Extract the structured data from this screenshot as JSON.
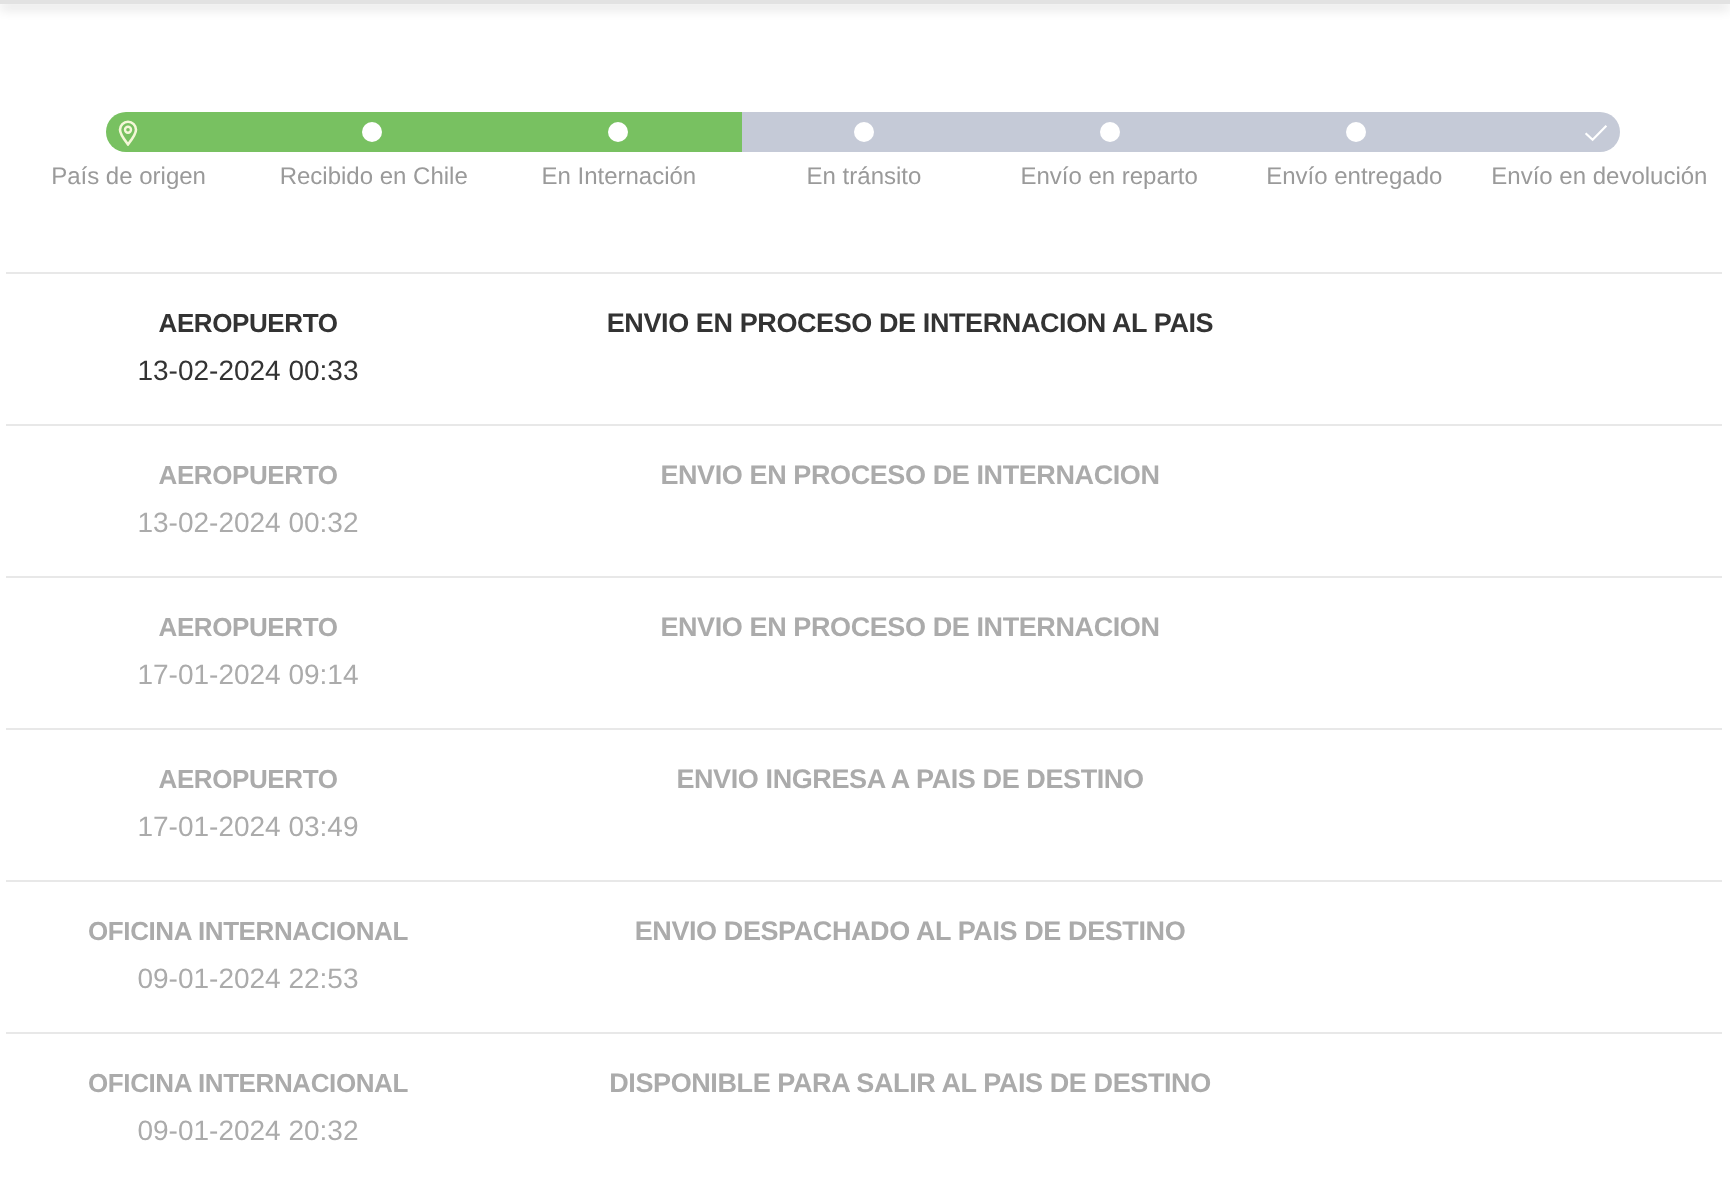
{
  "tracker": {
    "steps": [
      {
        "label": "País de origen",
        "kind": "origin",
        "done": true
      },
      {
        "label": "Recibido en Chile",
        "kind": "stage",
        "done": true
      },
      {
        "label": "En Internación",
        "kind": "stage",
        "done": true
      },
      {
        "label": "En tránsito",
        "kind": "stage",
        "done": false
      },
      {
        "label": "Envío en reparto",
        "kind": "stage",
        "done": false
      },
      {
        "label": "Envío entregado",
        "kind": "stage",
        "done": false
      },
      {
        "label": "Envío en devolución",
        "kind": "return",
        "done": false
      }
    ]
  },
  "events": [
    {
      "location": "AEROPUERTO",
      "datetime": "13-02-2024 00:33",
      "description": "ENVIO EN PROCESO DE INTERNACION AL PAIS",
      "current": true
    },
    {
      "location": "AEROPUERTO",
      "datetime": "13-02-2024 00:32",
      "description": "ENVIO EN PROCESO DE INTERNACION",
      "current": false
    },
    {
      "location": "AEROPUERTO",
      "datetime": "17-01-2024 09:14",
      "description": "ENVIO EN PROCESO DE INTERNACION",
      "current": false
    },
    {
      "location": "AEROPUERTO",
      "datetime": "17-01-2024 03:49",
      "description": "ENVIO INGRESA A PAIS DE DESTINO",
      "current": false
    },
    {
      "location": "OFICINA INTERNACIONAL",
      "datetime": "09-01-2024 22:53",
      "description": "ENVIO DESPACHADO AL PAIS DE DESTINO",
      "current": false
    },
    {
      "location": "OFICINA INTERNACIONAL",
      "datetime": "09-01-2024 20:32",
      "description": "DISPONIBLE PARA SALIR AL PAIS DE DESTINO",
      "current": false
    }
  ]
}
